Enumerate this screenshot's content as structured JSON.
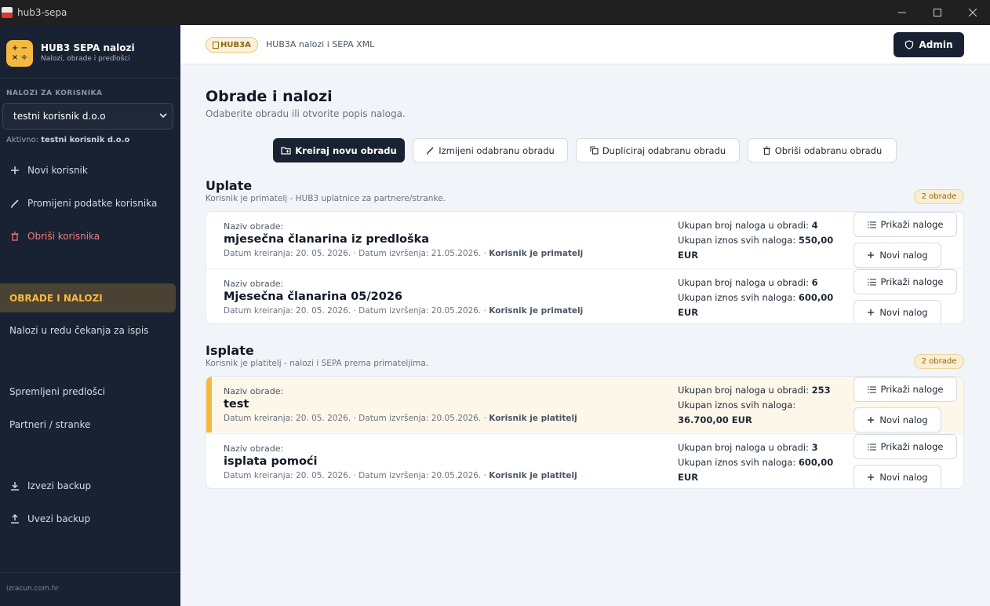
{
  "window": {
    "title": "hub3-sepa"
  },
  "brand": {
    "title": "HUB3 SEPA nalozi",
    "subtitle": "Nalozi, obrade i predlošci",
    "logo_glyphs": "+ -\n× ÷"
  },
  "sidebar": {
    "section_label": "NALOZI ZA KORISNIKA",
    "selected_user": "testni korisnik d.o.o",
    "active_prefix": "Aktivno:",
    "active_user": "testni korisnik d.o.o",
    "user_actions": [
      {
        "label": "Novi korisnik",
        "icon": "plus-icon"
      },
      {
        "label": "Promijeni podatke korisnika",
        "icon": "pencil-icon"
      },
      {
        "label": "Obriši korisnika",
        "icon": "trash-icon"
      }
    ],
    "nav": [
      {
        "label": "OBRADE I NALOZI",
        "active": true
      },
      {
        "label": "Nalozi u redu čekanja za ispis"
      },
      {
        "label": "Spremljeni predlošci"
      },
      {
        "label": "Partneri / stranke"
      }
    ],
    "backup": [
      {
        "label": "Izvezi backup",
        "icon": "download-icon"
      },
      {
        "label": "Uvezi backup",
        "icon": "upload-icon"
      }
    ],
    "footer": "izracun.com.hr"
  },
  "topbar": {
    "badge": "HUB3A",
    "text": "HUB3A nalozi i SEPA XML",
    "admin_label": "Admin"
  },
  "page": {
    "title": "Obrade i nalozi",
    "subtitle": "Odaberite obradu ili otvorite popis naloga."
  },
  "actions": {
    "create": "Kreiraj novu obradu",
    "edit": "Izmijeni odabranu obradu",
    "duplicate": "Dupliciraj odabranu obradu",
    "delete": "Obriši odabranu obradu"
  },
  "labels": {
    "naziv": "Naziv obrade:",
    "count_label": "Ukupan broj naloga u obradi:",
    "sum_label": "Ukupan iznos svih naloga:",
    "show_orders": "Prikaži naloge",
    "new_order": "Novi nalog"
  },
  "groups": [
    {
      "title": "Uplate",
      "subtitle": "Korisnik je primatelj - HUB3 uplatnice za partnere/stranke.",
      "badge": "2 obrade",
      "rows": [
        {
          "name": "mjesečna članarina iz predloška",
          "meta": "Datum kreiranja: 20. 05. 2026. · Datum izvršenja: 21.05.2026. ·",
          "role": "Korisnik je primatelj",
          "count": "4",
          "sum": "550,00",
          "sum_tail": "EUR"
        },
        {
          "name": "Mjesečna članarina 05/2026",
          "meta": "Datum kreiranja: 20. 05. 2026. · Datum izvršenja: 20.05.2026. ·",
          "role": "Korisnik je primatelj",
          "count": "6",
          "sum": "600,00",
          "sum_tail": "EUR"
        }
      ]
    },
    {
      "title": "Isplate",
      "subtitle": "Korisnik je platitelj - nalozi i SEPA prema primateljima.",
      "badge": "2 obrade",
      "rows": [
        {
          "name": "test",
          "meta": "Datum kreiranja: 20. 05. 2026. · Datum izvršenja: 20.05.2026. ·",
          "role": "Korisnik je platitelj",
          "count": "253",
          "sum": "",
          "sum_tail": "36.700,00 EUR"
        },
        {
          "name": "isplata pomoći",
          "meta": "Datum kreiranja: 20. 05. 2026. · Datum izvršenja: 20.05.2026. ·",
          "role": "Korisnik je platitelj",
          "count": "3",
          "sum": "600,00",
          "sum_tail": "EUR"
        }
      ]
    }
  ],
  "colors": {
    "sidebar": "#192232",
    "accent": "#f5b942",
    "highlight_row": "#fdf7ea"
  }
}
